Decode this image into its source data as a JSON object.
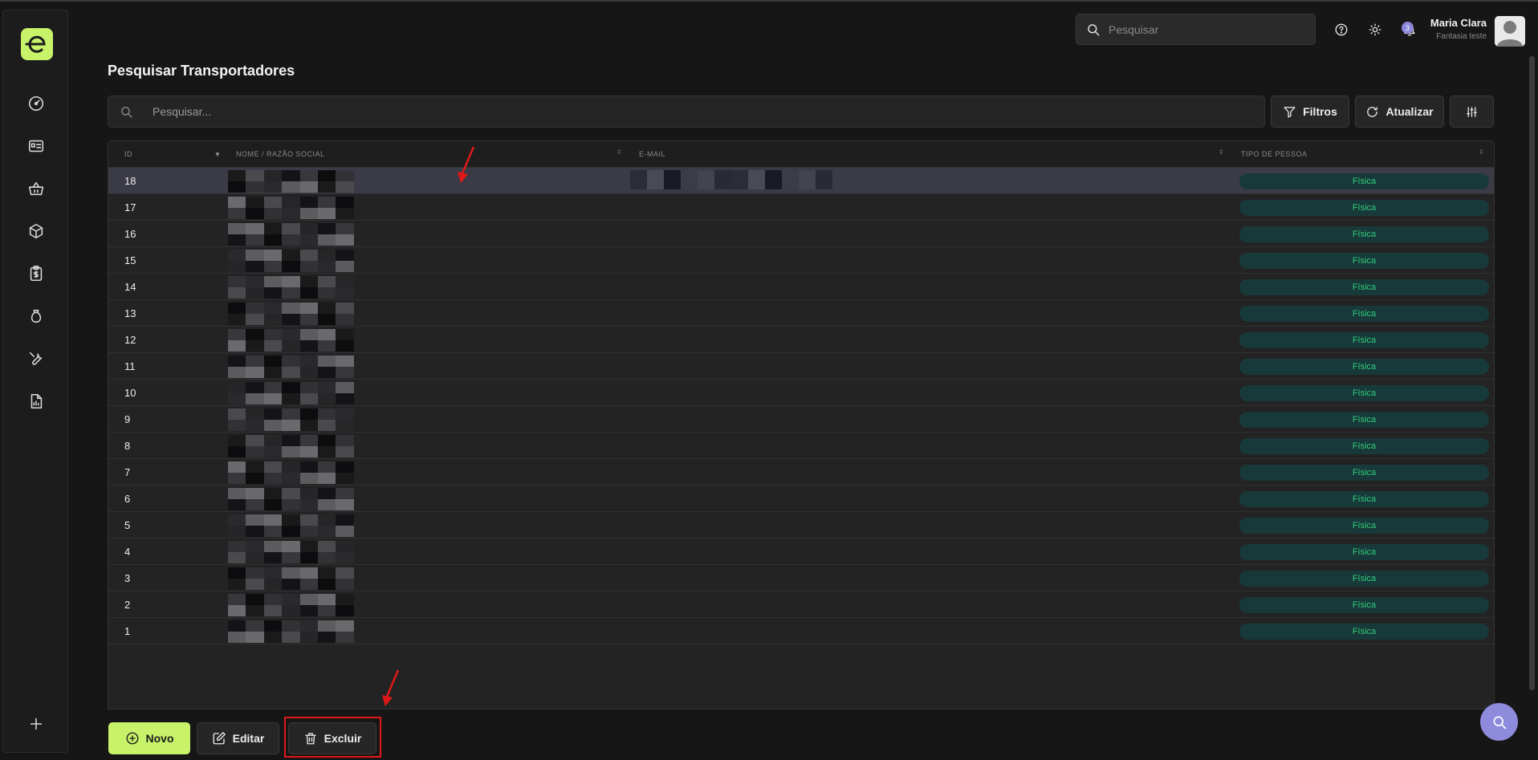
{
  "header": {
    "search_placeholder": "Pesquisar",
    "notifications_count": "3",
    "user_name": "Maria Clara",
    "user_company": "Fantasia teste"
  },
  "sidebar": {
    "items": [
      {
        "icon": "dashboard-gauge-icon"
      },
      {
        "icon": "id-card-icon"
      },
      {
        "icon": "shopping-basket-icon"
      },
      {
        "icon": "box-icon"
      },
      {
        "icon": "clipboard-dollar-icon"
      },
      {
        "icon": "money-bag-icon"
      },
      {
        "icon": "wrench-icon"
      },
      {
        "icon": "report-file-icon"
      }
    ],
    "add_icon": "plus-icon"
  },
  "page": {
    "title": "Pesquisar Transportadores",
    "search_placeholder": "Pesquisar...",
    "filters_label": "Filtros",
    "refresh_label": "Atualizar"
  },
  "table": {
    "columns": [
      "ID",
      "NOME / RAZÃO SOCIAL",
      "E-MAIL",
      "TIPO DE PESSOA"
    ],
    "rows": [
      {
        "id": "18",
        "tipo": "Física"
      },
      {
        "id": "17",
        "tipo": "Física"
      },
      {
        "id": "16",
        "tipo": "Física"
      },
      {
        "id": "15",
        "tipo": "Física"
      },
      {
        "id": "14",
        "tipo": "Física"
      },
      {
        "id": "13",
        "tipo": "Física"
      },
      {
        "id": "12",
        "tipo": "Física"
      },
      {
        "id": "11",
        "tipo": "Física"
      },
      {
        "id": "10",
        "tipo": "Física"
      },
      {
        "id": "9",
        "tipo": "Física"
      },
      {
        "id": "8",
        "tipo": "Física"
      },
      {
        "id": "7",
        "tipo": "Física"
      },
      {
        "id": "6",
        "tipo": "Física"
      },
      {
        "id": "5",
        "tipo": "Física"
      },
      {
        "id": "4",
        "tipo": "Física"
      },
      {
        "id": "3",
        "tipo": "Física"
      },
      {
        "id": "2",
        "tipo": "Física"
      },
      {
        "id": "1",
        "tipo": "Física"
      }
    ]
  },
  "actions": {
    "new_label": "Novo",
    "edit_label": "Editar",
    "delete_label": "Excluir"
  },
  "colors": {
    "accent": "#c8f26a",
    "badge_bg": "#18393a",
    "badge_text": "#2fd07a",
    "selected_row": "#3b3b47",
    "annotation_red": "#e01818",
    "fab": "#8f8bdc"
  }
}
